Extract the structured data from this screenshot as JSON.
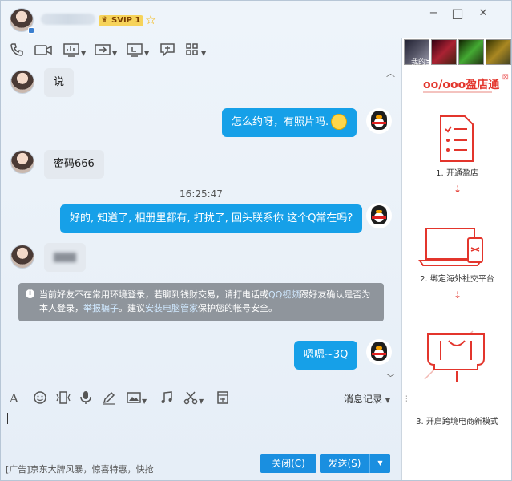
{
  "window": {
    "vip_label": "SVIP 1",
    "controls": [
      "−",
      "□",
      "✕"
    ]
  },
  "messages": {
    "m1": "说",
    "m2": "怎么约呀，有照片吗.",
    "m3": "密码666",
    "timestamp": "16:25:47",
    "m4": "好的, 知道了, 相册里都有, 打扰了, 回头联系你 这个Q常在吗?",
    "m6": "嗯嗯~3Q"
  },
  "notice": {
    "part1": "当前好友不在常用环境登录，若聊到钱财交易，请打电话或",
    "link1": "QQ视频",
    "part2": "跟好友确认是否为本人登录，",
    "link2": "举报骗子",
    "part3": "。建议",
    "link3": "安装电脑管家",
    "part4": "保护您的帐号安全。"
  },
  "input_toolbar": {
    "history_label": "消息记录"
  },
  "footer": {
    "ad_text": "[广告]京东大牌风暴，惊喜特惠，快抢",
    "close_label": "关闭(C)",
    "send_label": "发送(S)"
  },
  "right_panel": {
    "thumb_label": "我的宝贝",
    "logo_text": "oo/ooo盈店通",
    "step1": "1. 开通盈店",
    "step2": "2. 绑定海外社交平台",
    "step3": "3. 开启跨境电商新模式"
  },
  "colors": {
    "bubble_right": "#16a0e8",
    "bubble_left": "#e4e9ef",
    "button": "#1a8fe0",
    "brand_red": "#e3352c"
  }
}
